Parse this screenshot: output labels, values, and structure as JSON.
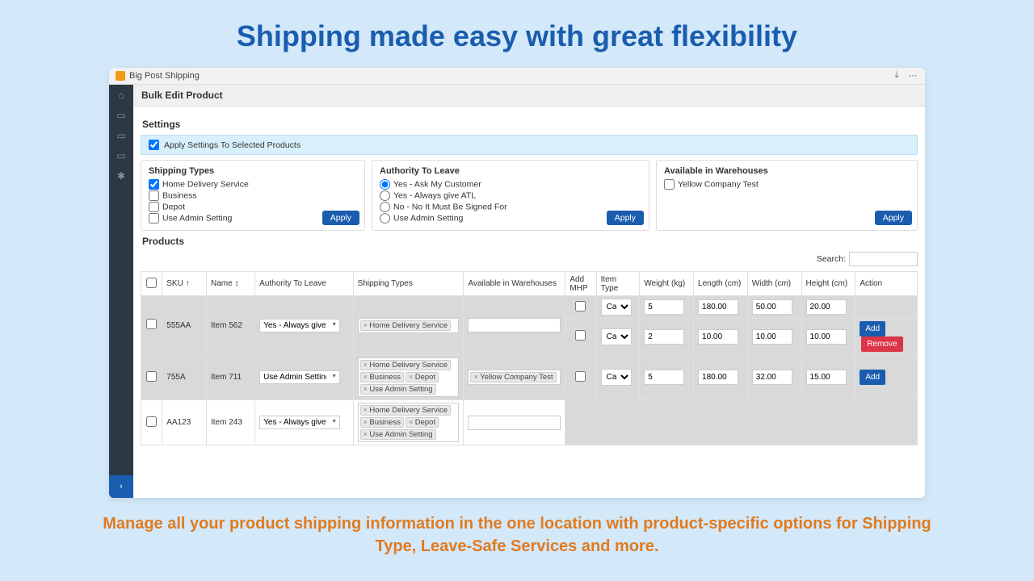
{
  "hero": "Shipping made easy with great flexibility",
  "footer": "Manage all your product shipping information in the one location with product-specific options for Shipping Type, Leave-Safe Services and more.",
  "app_title": "Big Post Shipping",
  "page_title": "Bulk Edit Product",
  "settings_title": "Settings",
  "apply_settings_label": "Apply Settings To Selected Products",
  "apply_label": "Apply",
  "panels": {
    "shipping_types": {
      "title": "Shipping Types",
      "opts": [
        "Home Delivery Service",
        "Business",
        "Depot",
        "Use Admin Setting"
      ]
    },
    "atl": {
      "title": "Authority To Leave",
      "opts": [
        "Yes - Ask My Customer",
        "Yes - Always give ATL",
        "No - No It Must Be Signed For",
        "Use Admin Setting"
      ]
    },
    "warehouses": {
      "title": "Available in Warehouses",
      "opts": [
        "Yellow Company Test"
      ]
    }
  },
  "products_title": "Products",
  "search_label": "Search:",
  "cols": {
    "sku": "SKU",
    "name": "Name",
    "atl": "Authority To Leave",
    "shipping": "Shipping Types",
    "wh": "Available in Warehouses",
    "addmhp": "Add MHP",
    "itemtype": "Item Type",
    "weight": "Weight (kg)",
    "length": "Length (cm)",
    "width": "Width (cm)",
    "height": "Height (cm)",
    "action": "Action"
  },
  "rows": [
    {
      "sku": "555AA",
      "name": "Item 562",
      "atl": "Yes - Always give ATL",
      "shipping": [
        "Home Delivery Service"
      ],
      "wh": [],
      "lines": [
        {
          "itemtype": "Cartor",
          "w": "5",
          "l": "180.00",
          "wd": "50.00",
          "h": "20.00",
          "actions": []
        },
        {
          "itemtype": "Cartor",
          "w": "2",
          "l": "10.00",
          "wd": "10.00",
          "h": "10.00",
          "actions": [
            "Add",
            "Remove"
          ]
        }
      ]
    },
    {
      "sku": "755A",
      "name": "Item 711",
      "atl": "Use Admin Setting",
      "shipping": [
        "Home Delivery Service",
        "Business",
        "Depot",
        "Use Admin Setting"
      ],
      "wh": [
        "Yellow Company Test"
      ],
      "lines": [
        {
          "itemtype": "Cartor",
          "w": "5",
          "l": "180.00",
          "wd": "32.00",
          "h": "15.00",
          "actions": [
            "Add"
          ]
        }
      ]
    },
    {
      "sku": "AA123",
      "name": "Item 243",
      "atl": "Yes - Always give ATL",
      "shipping": [
        "Home Delivery Service",
        "Business",
        "Depot",
        "Use Admin Setting"
      ],
      "wh": [],
      "lines": []
    }
  ],
  "btn_add": "Add",
  "btn_remove": "Remove"
}
